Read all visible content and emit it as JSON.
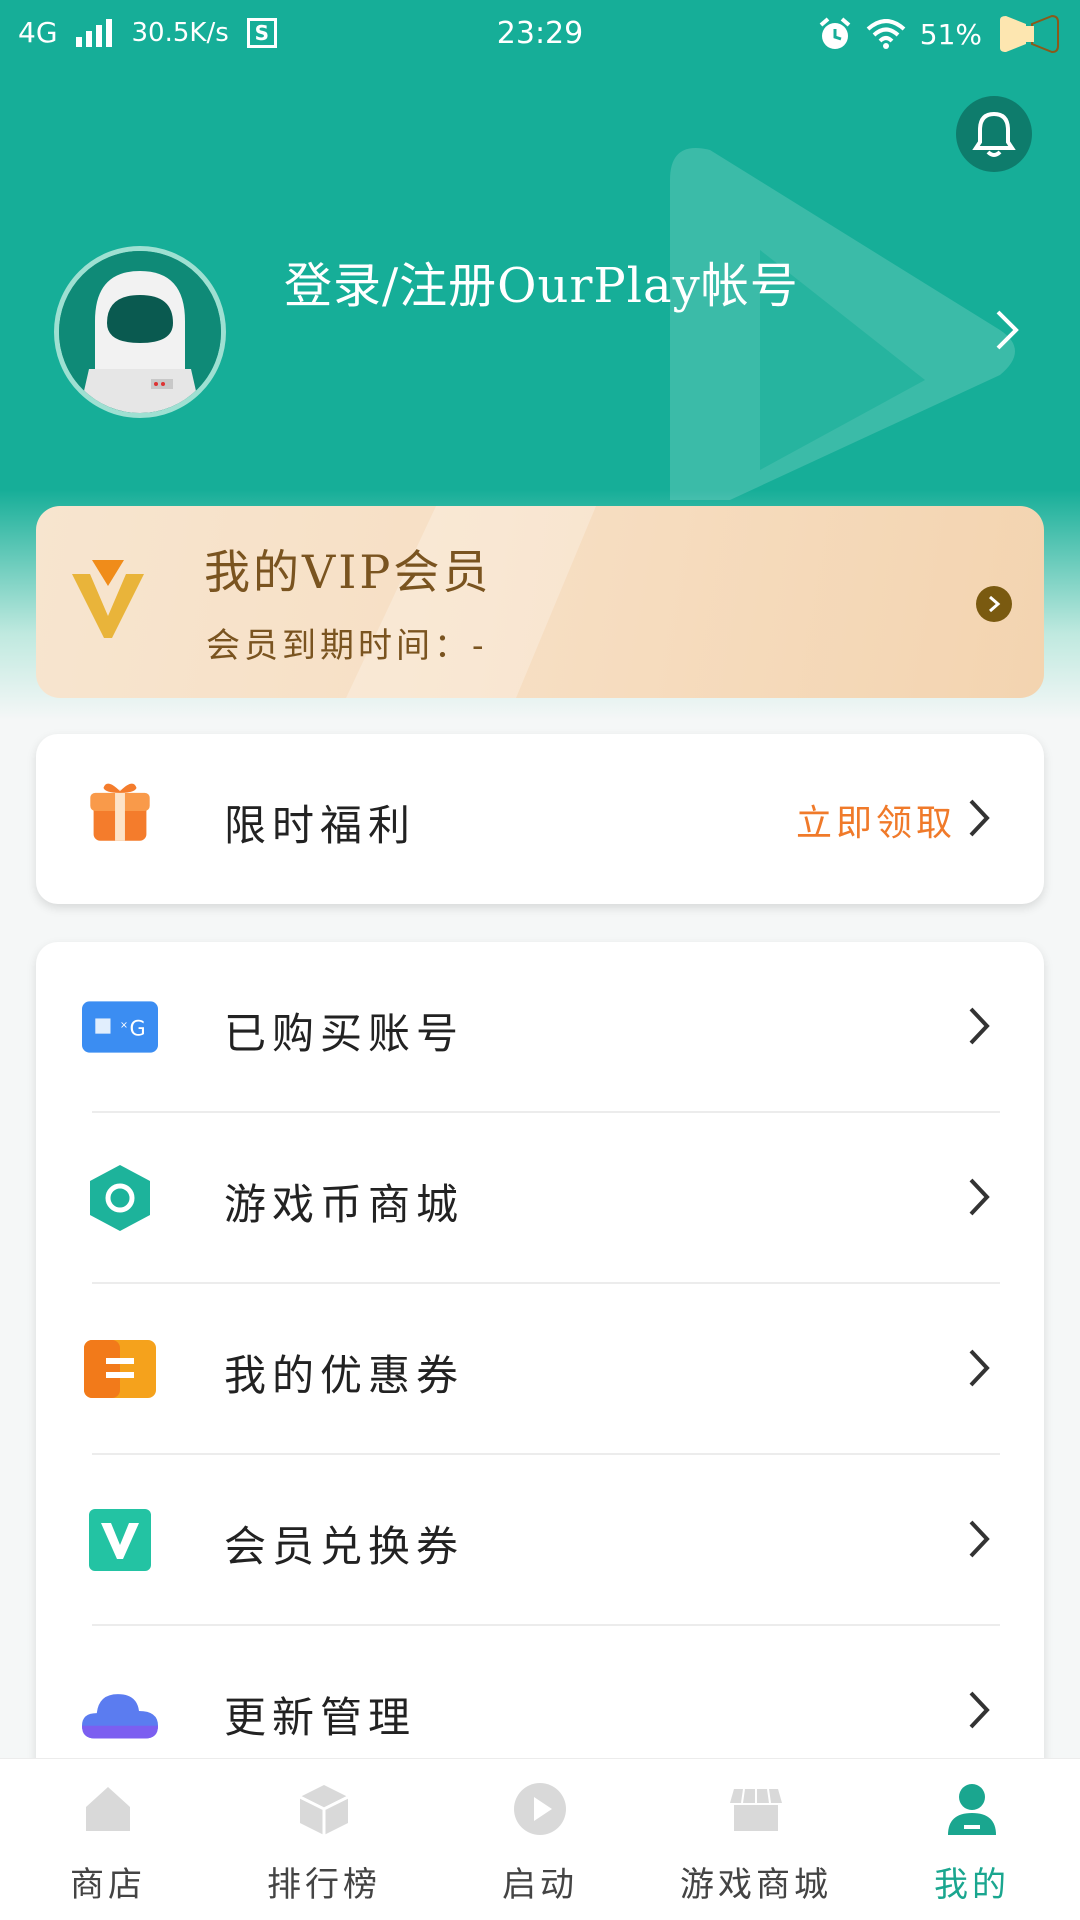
{
  "status_bar": {
    "network": "4G",
    "speed": "30.5K/s",
    "s_icon": "S",
    "time": "23:29",
    "battery": "51%"
  },
  "profile": {
    "login_text": "登录/注册OurPlay帐号"
  },
  "vip": {
    "title": "我的VIP会员",
    "expire": "会员到期时间：-"
  },
  "welfare": {
    "label": "限时福利",
    "action": "立即领取",
    "icon": "gift-icon"
  },
  "menu": [
    {
      "label": "已购买账号",
      "icon": "account-icon"
    },
    {
      "label": "游戏币商城",
      "icon": "coin-shop-icon"
    },
    {
      "label": "我的优惠券",
      "icon": "coupon-icon"
    },
    {
      "label": "会员兑换券",
      "icon": "vip-voucher-icon"
    },
    {
      "label": "更新管理",
      "icon": "cloud-icon"
    }
  ],
  "tabs": [
    {
      "label": "商店",
      "icon": "home-icon"
    },
    {
      "label": "排行榜",
      "icon": "cube-icon"
    },
    {
      "label": "启动",
      "icon": "play-icon"
    },
    {
      "label": "游戏商城",
      "icon": "store-icon"
    },
    {
      "label": "我的",
      "icon": "user-icon",
      "active": true
    }
  ],
  "colors": {
    "primary": "#16ae98",
    "accent_orange": "#f07a2a",
    "vip_brown": "#7a5420"
  }
}
